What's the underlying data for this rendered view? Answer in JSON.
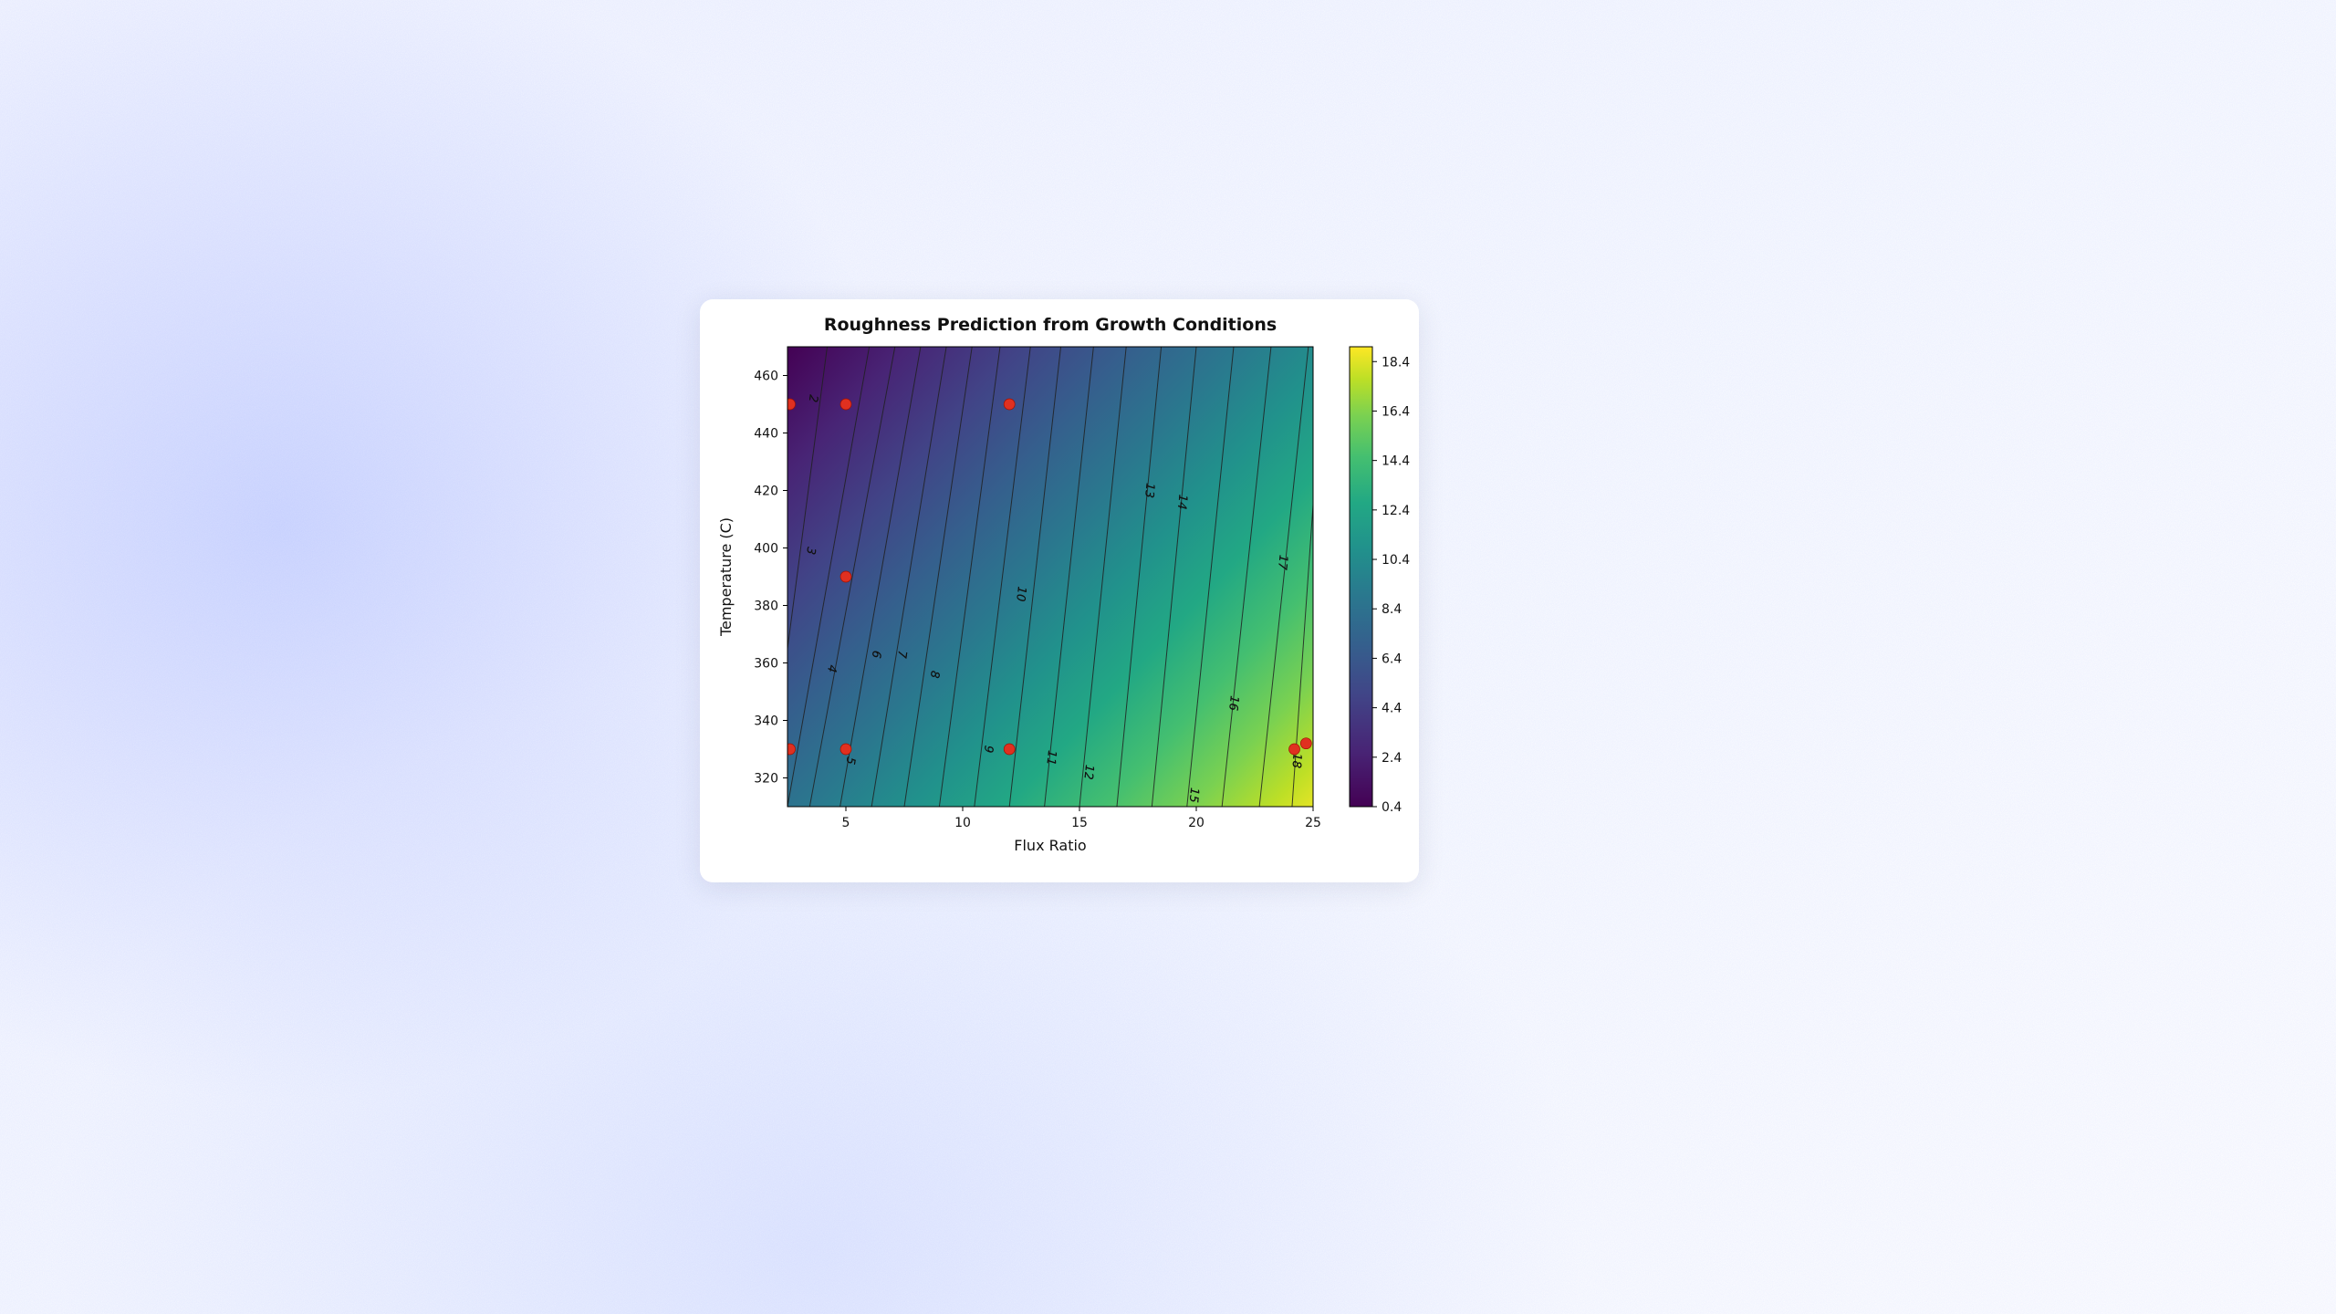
{
  "chart_data": {
    "type": "heatmap",
    "title": "Roughness Prediction from Growth Conditions",
    "xlabel": "Flux Ratio",
    "ylabel": "Temperature (C)",
    "x_ticks": [
      5,
      10,
      15,
      20,
      25
    ],
    "y_ticks": [
      320,
      340,
      360,
      380,
      400,
      420,
      440,
      460
    ],
    "xlim": [
      2.5,
      25
    ],
    "ylim": [
      310,
      470
    ],
    "contour_levels": [
      2,
      3,
      4,
      5,
      6,
      7,
      8,
      9,
      10,
      11,
      12,
      13,
      14,
      15,
      16,
      17,
      18
    ],
    "contour_endpoints": {
      "2": {
        "x0": 4.2,
        "y0": 470,
        "x1": 2.5,
        "y1": 365
      },
      "3": {
        "x0": 6.0,
        "y0": 470,
        "x1": 2.5,
        "y1": 310
      },
      "4": {
        "x0": 7.1,
        "y0": 470,
        "x1": 3.45,
        "y1": 310
      },
      "5": {
        "x0": 8.2,
        "y0": 470,
        "x1": 4.75,
        "y1": 310
      },
      "6": {
        "x0": 9.3,
        "y0": 470,
        "x1": 6.1,
        "y1": 310
      },
      "7": {
        "x0": 10.4,
        "y0": 470,
        "x1": 7.5,
        "y1": 310
      },
      "8": {
        "x0": 11.6,
        "y0": 470,
        "x1": 9.0,
        "y1": 310
      },
      "9": {
        "x0": 12.9,
        "y0": 470,
        "x1": 10.5,
        "y1": 310
      },
      "10": {
        "x0": 14.2,
        "y0": 470,
        "x1": 12.0,
        "y1": 310
      },
      "11": {
        "x0": 15.6,
        "y0": 470,
        "x1": 13.5,
        "y1": 310
      },
      "12": {
        "x0": 17.0,
        "y0": 470,
        "x1": 15.0,
        "y1": 310
      },
      "13": {
        "x0": 18.5,
        "y0": 470,
        "x1": 16.6,
        "y1": 310
      },
      "14": {
        "x0": 20.0,
        "y0": 470,
        "x1": 18.1,
        "y1": 310
      },
      "15": {
        "x0": 21.6,
        "y0": 470,
        "x1": 19.6,
        "y1": 310
      },
      "16": {
        "x0": 23.2,
        "y0": 470,
        "x1": 21.1,
        "y1": 310
      },
      "17": {
        "x0": 24.8,
        "y0": 470,
        "x1": 22.7,
        "y1": 310
      },
      "18": {
        "x0": 25.0,
        "y0": 415,
        "x1": 24.1,
        "y1": 310
      }
    },
    "contour_label_positions": {
      "2": [
        3.6,
        452
      ],
      "3": [
        3.5,
        399
      ],
      "4": [
        4.4,
        358
      ],
      "5": [
        5.2,
        326
      ],
      "6": [
        6.3,
        363
      ],
      "7": [
        7.4,
        363
      ],
      "8": [
        8.8,
        356
      ],
      "9": [
        11.1,
        330
      ],
      "10": [
        12.5,
        384
      ],
      "11": [
        13.8,
        327
      ],
      "12": [
        15.4,
        322
      ],
      "13": [
        18.0,
        420
      ],
      "14": [
        19.4,
        416
      ],
      "15": [
        19.9,
        314
      ],
      "16": [
        21.6,
        346
      ],
      "17": [
        23.7,
        395
      ],
      "18": [
        24.3,
        326
      ]
    },
    "scatter_points": [
      {
        "x": 2.6,
        "y": 450
      },
      {
        "x": 5,
        "y": 450
      },
      {
        "x": 12,
        "y": 450
      },
      {
        "x": 5,
        "y": 390
      },
      {
        "x": 2.6,
        "y": 330
      },
      {
        "x": 5,
        "y": 330
      },
      {
        "x": 12,
        "y": 330
      },
      {
        "x": 24.2,
        "y": 330
      },
      {
        "x": 24.7,
        "y": 332
      }
    ],
    "colorbar_ticks": [
      0.4,
      2.4,
      4.4,
      6.4,
      8.4,
      10.4,
      12.4,
      14.4,
      16.4,
      18.4
    ],
    "zlim": [
      0.4,
      19.0
    ]
  }
}
